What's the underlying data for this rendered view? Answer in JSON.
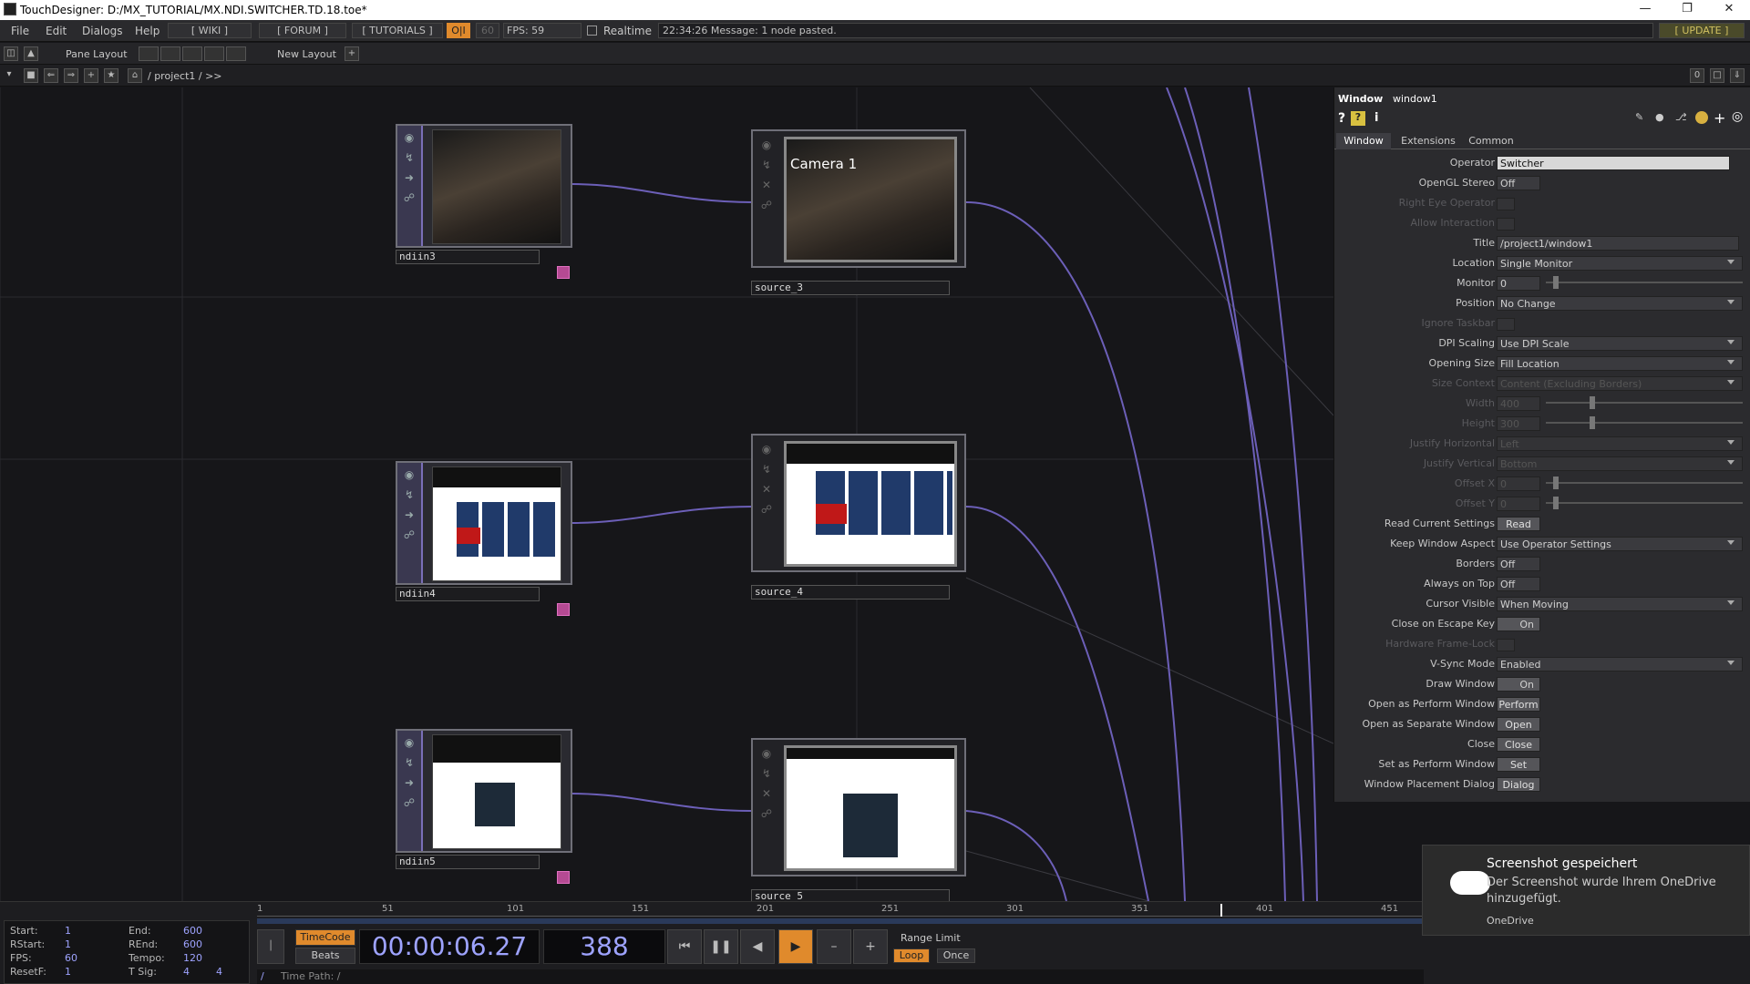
{
  "window": {
    "title": "TouchDesigner: D:/MX_TUTORIAL/MX.NDI.SWITCHER.TD.18.toe*"
  },
  "menu": {
    "items": [
      "File",
      "Edit",
      "Dialogs",
      "Help"
    ],
    "links": [
      "[ WIKI ]",
      "[ FORUM ]",
      "[ TUTORIALS ]"
    ],
    "oi": "O|I",
    "fps_cap": "60",
    "fps": "FPS: 59",
    "realtime": "Realtime",
    "message": "22:34:26 Message: 1 node pasted.",
    "update": "[ UPDATE ]"
  },
  "toolbar": {
    "pane_layout": "Pane Layout",
    "new_layout": "New Layout",
    "path": "/ project1 / >>",
    "zero": "0"
  },
  "nodes": {
    "ndiin3": "ndiin3",
    "ndiin4": "ndiin4",
    "ndiin5": "ndiin5",
    "source_3": "source_3",
    "source_4": "source_4",
    "source_5": "source_5",
    "camera_label": "Camera 1"
  },
  "params": {
    "header_type": "Window",
    "header_name": "window1",
    "tabs": [
      "Window",
      "Extensions",
      "Common"
    ],
    "rows": [
      {
        "label": "Operator",
        "value": "Switcher"
      },
      {
        "label": "OpenGL Stereo",
        "value": "Off"
      },
      {
        "label": "Right Eye Operator",
        "value": ""
      },
      {
        "label": "Allow Interaction",
        "value": ""
      },
      {
        "label": "Title",
        "value": "/project1/window1"
      },
      {
        "label": "Location",
        "value": "Single Monitor"
      },
      {
        "label": "Monitor",
        "value": "0"
      },
      {
        "label": "Position",
        "value": "No Change"
      },
      {
        "label": "Ignore Taskbar",
        "value": ""
      },
      {
        "label": "DPI Scaling",
        "value": "Use DPI Scale"
      },
      {
        "label": "Opening Size",
        "value": "Fill Location"
      },
      {
        "label": "Size Context",
        "value": "Content (Excluding Borders)"
      },
      {
        "label": "Width",
        "value": "400"
      },
      {
        "label": "Height",
        "value": "300"
      },
      {
        "label": "Justify Horizontal",
        "value": "Left"
      },
      {
        "label": "Justify Vertical",
        "value": "Bottom"
      },
      {
        "label": "Offset X",
        "value": "0"
      },
      {
        "label": "Offset Y",
        "value": "0"
      },
      {
        "label": "Read Current Settings",
        "value": "Read"
      },
      {
        "label": "Keep Window Aspect",
        "value": "Use Operator Settings"
      },
      {
        "label": "Borders",
        "value": "Off"
      },
      {
        "label": "Always on Top",
        "value": "Off"
      },
      {
        "label": "Cursor Visible",
        "value": "When Moving"
      },
      {
        "label": "Close on Escape Key",
        "value": "On"
      },
      {
        "label": "Hardware Frame-Lock",
        "value": ""
      },
      {
        "label": "V-Sync Mode",
        "value": "Enabled"
      },
      {
        "label": "Draw Window",
        "value": "On"
      },
      {
        "label": "Open as Perform Window",
        "value": "Perform"
      },
      {
        "label": "Open as Separate Window",
        "value": "Open"
      },
      {
        "label": "Close",
        "value": "Close"
      },
      {
        "label": "Set as Perform Window",
        "value": "Set"
      },
      {
        "label": "Window Placement Dialog",
        "value": "Dialog"
      }
    ]
  },
  "timeline": {
    "ruler": [
      "1",
      "51",
      "101",
      "151",
      "201",
      "251",
      "301",
      "351",
      "401",
      "451"
    ],
    "start_l": "Start:",
    "start": "1",
    "end_l": "End:",
    "end": "600",
    "rstart_l": "RStart:",
    "rstart": "1",
    "rend_l": "REnd:",
    "rend": "600",
    "fps_l": "FPS:",
    "fps": "60",
    "tempo_l": "Tempo:",
    "tempo": "120",
    "resetf_l": "ResetF:",
    "resetf": "1",
    "tsig_l": "T Sig:",
    "tsig_a": "4",
    "tsig_b": "4",
    "timecode": "TimeCode",
    "beats": "Beats",
    "time": "00:00:06.27",
    "frame": "388",
    "range_limit": "Range Limit",
    "loop": "Loop",
    "once": "Once",
    "timepath": "Time Path: /"
  },
  "toast": {
    "title": "Screenshot gespeichert",
    "body": "Der Screenshot wurde Ihrem OneDrive hinzugefügt.",
    "app": "OneDrive"
  },
  "colors": {
    "accent": "#e08a2c",
    "wire": "#6c5fb8"
  }
}
